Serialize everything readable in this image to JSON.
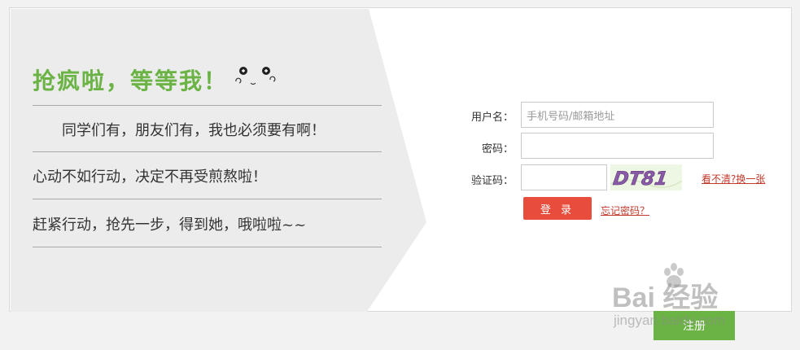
{
  "promo": {
    "title": "抢疯啦，等等我！",
    "lines": [
      "　　同学们有，朋友们有，我也必须要有啊！",
      "心动不如行动，决定不再受煎熬啦！",
      "赶紧行动，抢先一步，得到她，哦啦啦~~"
    ]
  },
  "form": {
    "username_label": "用户名：",
    "username_placeholder": "手机号码/邮箱地址",
    "password_label": "密码：",
    "captcha_label": "验证码：",
    "captcha_text": "DT81",
    "refresh_link": "看不清?换一张",
    "login_label": "登 录",
    "forgot_link": "忘记密码？",
    "register_label": "注册"
  },
  "watermark": {
    "main": "Bai 经验",
    "sub": "jingyan.baidu.com"
  },
  "colors": {
    "brand_green": "#6ab344",
    "login_red": "#e74c3c",
    "link_red": "#c0392b"
  }
}
